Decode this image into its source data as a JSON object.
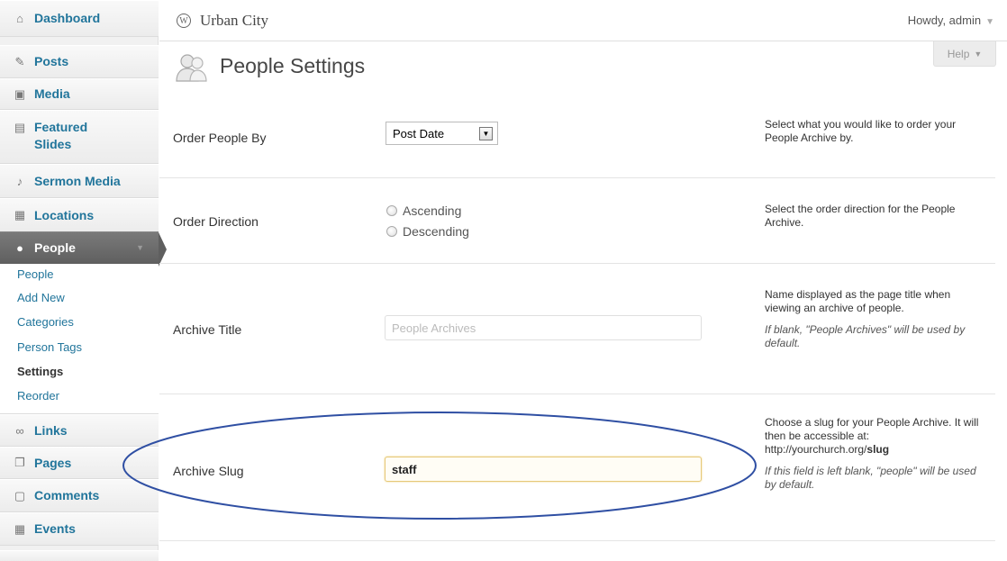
{
  "sidebar": {
    "items": [
      {
        "label": "Dashboard",
        "icon": "home-icon"
      },
      {
        "label": "Posts",
        "icon": "pin-icon"
      },
      {
        "label": "Media",
        "icon": "media-icon"
      },
      {
        "label": "Featured\nSlides",
        "icon": "slides-icon"
      },
      {
        "label": "Sermon Media",
        "icon": "microphone-icon"
      },
      {
        "label": "Locations",
        "icon": "map-icon"
      },
      {
        "label": "People",
        "icon": "person-icon"
      },
      {
        "label": "Links",
        "icon": "link-icon"
      },
      {
        "label": "Pages",
        "icon": "pages-icon"
      },
      {
        "label": "Comments",
        "icon": "comment-icon"
      },
      {
        "label": "Events",
        "icon": "calendar-icon"
      }
    ],
    "submenu": [
      "People",
      "Add New",
      "Categories",
      "Person Tags",
      "Settings",
      "Reorder"
    ],
    "current_submenu": "Settings"
  },
  "header": {
    "site_title": "Urban City",
    "howdy": "Howdy, admin",
    "help": "Help"
  },
  "page": {
    "title": "People Settings"
  },
  "settings": {
    "order_by": {
      "label": "Order People By",
      "value": "Post Date",
      "description": "Select what you would like to order your People Archive by."
    },
    "order_direction": {
      "label": "Order Direction",
      "options": [
        "Ascending",
        "Descending"
      ],
      "description": "Select the order direction for the People Archive."
    },
    "archive_title": {
      "label": "Archive Title",
      "placeholder": "People Archives",
      "value": "",
      "description": "Name displayed as the page title when viewing an archive of people.",
      "note": "If blank, \"People Archives\" will be used by default."
    },
    "archive_slug": {
      "label": "Archive Slug",
      "value": "staff",
      "description_prefix": "Choose a slug for your People Archive. It will then be accessible at: http://yourchurch.org/",
      "description_bold": "slug",
      "note": "If this field is left blank, \"people\" will be used by default."
    }
  },
  "colors": {
    "link": "#21759b",
    "active_menu": "#6d6d6d",
    "highlight_ellipse": "#2f4fa3",
    "focus_border": "#e6c878"
  }
}
